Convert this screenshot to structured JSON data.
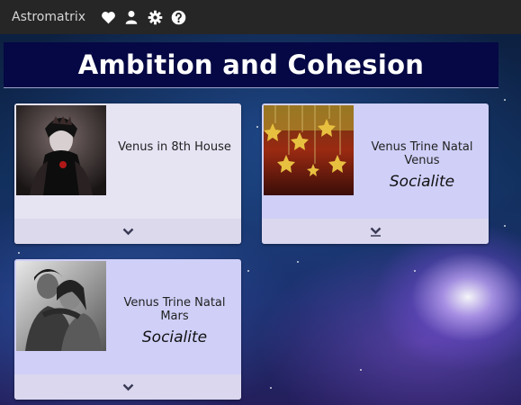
{
  "app": {
    "name": "Astromatrix"
  },
  "toolbar": {
    "icons": [
      "heart-icon",
      "user-icon",
      "gear-icon",
      "help-icon"
    ]
  },
  "page": {
    "title": "Ambition and Cohesion"
  },
  "cards": [
    {
      "title": "Venus in 8th House",
      "subtitle": ""
    },
    {
      "title": "Venus Trine Natal Venus",
      "subtitle": "Socialite"
    },
    {
      "title": "Venus Trine Natal Mars",
      "subtitle": "Socialite"
    }
  ],
  "colors": {
    "topbar": "#262626",
    "title_bg": "#050844",
    "card_bg": "#cfcff8",
    "card_bg_alt": "#e6e3f3"
  }
}
